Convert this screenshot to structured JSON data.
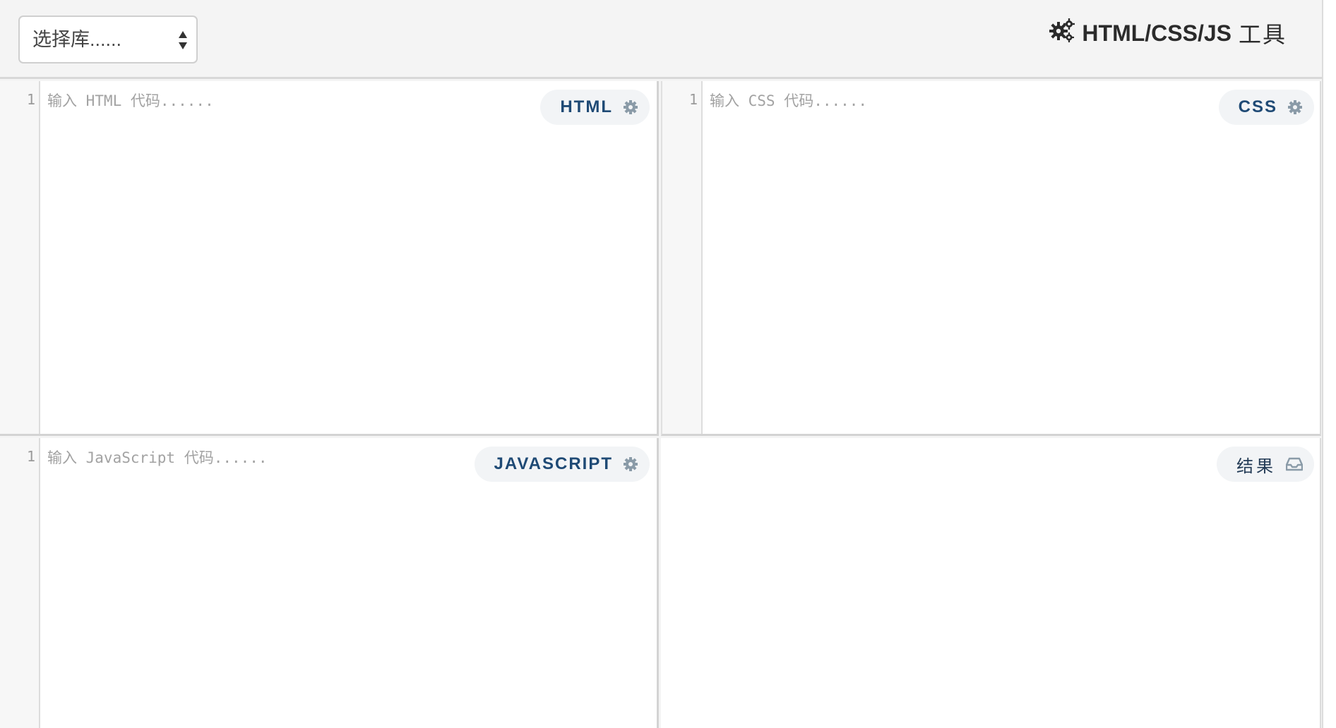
{
  "header": {
    "library_select": {
      "placeholder": "选择库......"
    },
    "brand": {
      "icon": "cogs-icon",
      "title_en": "HTML/CSS/JS",
      "title_cn": "工具"
    }
  },
  "panels": {
    "html": {
      "line_number": "1",
      "placeholder": "输入 HTML 代码......",
      "label": "HTML",
      "icon": "gear-icon"
    },
    "css": {
      "line_number": "1",
      "placeholder": "输入 CSS 代码......",
      "label": "CSS",
      "icon": "gear-icon"
    },
    "javascript": {
      "line_number": "1",
      "placeholder": "输入 JavaScript 代码......",
      "label": "JAVASCRIPT",
      "icon": "gear-icon"
    },
    "result": {
      "label": "结果",
      "icon": "inbox-icon"
    }
  },
  "colors": {
    "background": "#f4f4f4",
    "panel": "#ffffff",
    "pill_bg": "#f2f4f6",
    "pill_text": "#1f4a75",
    "icon_gray": "#8a9ba8"
  }
}
